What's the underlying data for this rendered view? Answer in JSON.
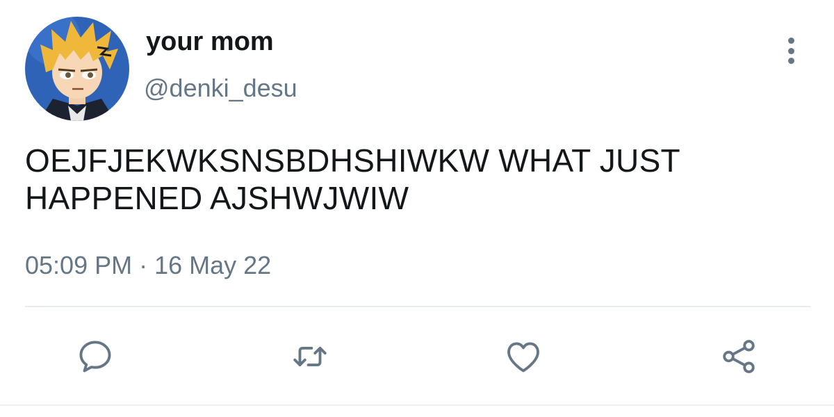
{
  "user": {
    "display_name": "your mom",
    "handle": "@denki_desu",
    "avatar_icon": "profile-avatar"
  },
  "tweet": {
    "text": "OEJFJEKWKSNSBDHSHIWKW WHAT JUST HAPPENED AJSHWJWIW",
    "time": "05:09 PM",
    "separator": "·",
    "date": "16 May 22"
  },
  "actions": {
    "reply_icon": "comment-bubble-icon",
    "retweet_icon": "retweet-icon",
    "like_icon": "heart-icon",
    "share_icon": "share-icon"
  },
  "menu": {
    "more_icon": "vertical-dots-icon"
  },
  "colors": {
    "text_primary": "#14171a",
    "text_secondary": "#657786",
    "divider": "#e6ecf0",
    "icon": "#657786"
  }
}
